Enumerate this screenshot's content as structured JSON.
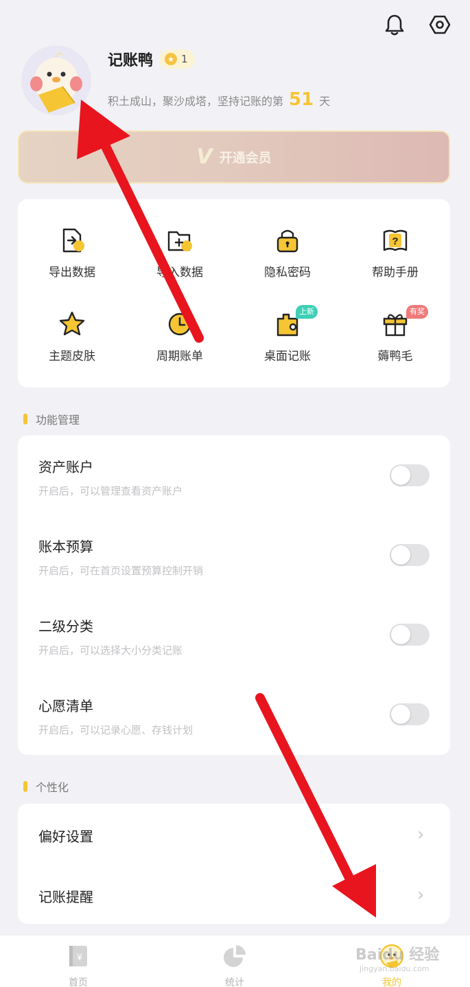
{
  "header": {
    "bell_icon": "bell-icon",
    "settings_icon": "hexagon-settings-icon"
  },
  "profile": {
    "name": "记账鸭",
    "level": "1",
    "motto_prefix": "积土成山，聚沙成塔，坚持记账的第",
    "days": "51",
    "motto_suffix": "天"
  },
  "vip": {
    "label": "开通会员"
  },
  "grid": {
    "items": [
      {
        "label": "导出数据",
        "icon": "export-file-icon"
      },
      {
        "label": "导入数据",
        "icon": "import-folder-icon"
      },
      {
        "label": "隐私密码",
        "icon": "lock-icon"
      },
      {
        "label": "帮助手册",
        "icon": "help-book-icon"
      },
      {
        "label": "主题皮肤",
        "icon": "star-theme-icon"
      },
      {
        "label": "周期账单",
        "icon": "clock-icon"
      },
      {
        "label": "桌面记账",
        "icon": "widget-icon",
        "tag": "上新"
      },
      {
        "label": "薅鸭毛",
        "icon": "gift-icon",
        "tag": "有奖"
      }
    ]
  },
  "sections": {
    "features": "功能管理",
    "personal": "个性化"
  },
  "toggles": [
    {
      "title": "资产账户",
      "desc": "开启后，可以管理查看资产账户",
      "on": false
    },
    {
      "title": "账本预算",
      "desc": "开启后，可在首页设置预算控制开销",
      "on": false
    },
    {
      "title": "二级分类",
      "desc": "开启后，可以选择大小分类记账",
      "on": false
    },
    {
      "title": "心愿清单",
      "desc": "开启后，可以记录心愿、存钱计划",
      "on": false
    }
  ],
  "personal_items": [
    {
      "title": "偏好设置"
    },
    {
      "title": "记账提醒"
    }
  ],
  "nav": {
    "items": [
      {
        "label": "首页",
        "icon": "ledger-icon"
      },
      {
        "label": "统计",
        "icon": "pie-chart-icon"
      },
      {
        "label": "我的",
        "icon": "duck-profile-icon"
      }
    ],
    "active": "我的"
  },
  "watermark": {
    "text": "Baidu 经验",
    "sub": "jingyan.baidu.com"
  },
  "colors": {
    "accent": "#f5c533",
    "background": "#f2f2f6",
    "arrow": "#e8151e",
    "tag_new": "#3fcfb7",
    "tag_prize": "#f07a7a"
  }
}
